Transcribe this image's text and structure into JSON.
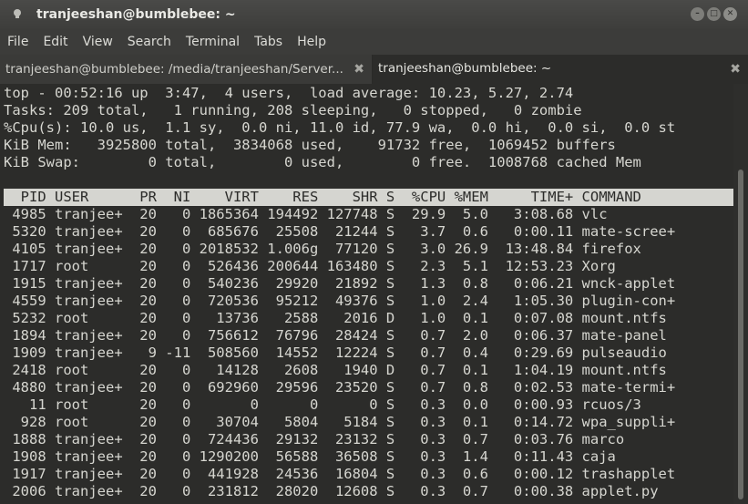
{
  "window": {
    "title": "tranjeeshan@bumblebee: ~"
  },
  "menu": [
    "File",
    "Edit",
    "View",
    "Search",
    "Terminal",
    "Tabs",
    "Help"
  ],
  "tabs": [
    {
      "label": "tranjeeshan@bumblebee: /media/tranjeeshan/Server..."
    },
    {
      "label": "tranjeeshan@bumblebee: ~"
    }
  ],
  "summary": [
    "top - 00:52:16 up  3:47,  4 users,  load average: 10.23, 5.27, 2.74",
    "Tasks: 209 total,   1 running, 208 sleeping,   0 stopped,   0 zombie",
    "%Cpu(s): 10.0 us,  1.1 sy,  0.0 ni, 11.0 id, 77.9 wa,  0.0 hi,  0.0 si,  0.0 st",
    "KiB Mem:   3925800 total,  3834068 used,    91732 free,  1069452 buffers",
    "KiB Swap:        0 total,        0 used,        0 free.  1008768 cached Mem"
  ],
  "header": "  PID USER      PR  NI    VIRT    RES    SHR S  %CPU %MEM     TIME+ COMMAND",
  "processes": [
    " 4985 tranjee+  20   0 1865364 194492 127748 S  29.9  5.0   3:08.68 vlc",
    " 5320 tranjee+  20   0  685676  25508  21244 S   3.7  0.6   0:00.11 mate-scree+",
    " 4105 tranjee+  20   0 2018532 1.006g  77120 S   3.0 26.9  13:48.84 firefox",
    " 1717 root      20   0  526436 200644 163480 S   2.3  5.1  12:53.23 Xorg",
    " 1915 tranjee+  20   0  540236  29920  21892 S   1.3  0.8   0:06.21 wnck-applet",
    " 4559 tranjee+  20   0  720536  95212  49376 S   1.0  2.4   1:05.30 plugin-con+",
    " 5232 root      20   0   13736   2588   2016 D   1.0  0.1   0:07.08 mount.ntfs",
    " 1894 tranjee+  20   0  756612  76796  28424 S   0.7  2.0   0:06.37 mate-panel",
    " 1909 tranjee+   9 -11  508560  14552  12224 S   0.7  0.4   0:29.69 pulseaudio",
    " 2418 root      20   0   14128   2608   1940 D   0.7  0.1   1:04.19 mount.ntfs",
    " 4880 tranjee+  20   0  692960  29596  23520 S   0.7  0.8   0:02.53 mate-termi+",
    "   11 root      20   0       0      0      0 S   0.3  0.0   0:00.93 rcuos/3",
    "  928 root      20   0   30704   5804   5184 S   0.3  0.1   0:14.72 wpa_suppli+",
    " 1888 tranjee+  20   0  724436  29132  23132 S   0.3  0.7   0:03.76 marco",
    " 1908 tranjee+  20   0 1290200  56588  36508 S   0.3  1.4   0:11.43 caja",
    " 1917 tranjee+  20   0  441928  24536  16804 S   0.3  0.6   0:00.12 trashapplet",
    " 2006 tranjee+  20   0  231812  28020  12608 S   0.3  0.7   0:00.38 applet.py"
  ]
}
